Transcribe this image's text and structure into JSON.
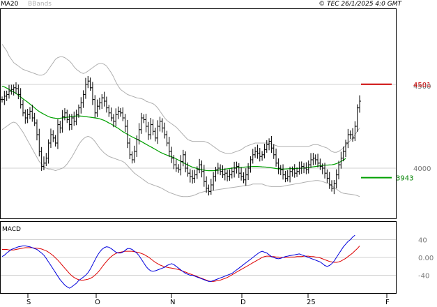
{
  "header": {
    "legend_ma": "MA20",
    "legend_bbands": "BBands",
    "copyright": "© TEC 26/1/2025 4:0 GMT"
  },
  "colors": {
    "ma20": "#00a000",
    "bbands": "#b0b0b0",
    "bars": "#000000",
    "macd_line": "#0000dd",
    "signal_line": "#dd0000",
    "resistance": "#cc0000",
    "support": "#00a000",
    "grid": "#d0d0d0",
    "axis": "#000000"
  },
  "chart_data": [
    {
      "type": "line",
      "title": "",
      "xlabel": "",
      "ylabel": "",
      "ylim": [
        3700,
        4950
      ],
      "x_tick_labels": [
        "S",
        "O",
        "N",
        "D",
        "25",
        "F"
      ],
      "y_tick_labels": [
        "4500",
        "4000"
      ],
      "levels": [
        {
          "name": "resistance",
          "label": "4501",
          "value": 4501
        },
        {
          "name": "support",
          "label": "3943",
          "value": 3943
        }
      ],
      "series": [
        {
          "name": "price",
          "style": "ohlc-bars",
          "values": [
            4410,
            4430,
            4440,
            4460,
            4470,
            4480,
            4475,
            4440,
            4380,
            4330,
            4300,
            4320,
            4340,
            4300,
            4270,
            4200,
            4100,
            4010,
            4030,
            4060,
            4150,
            4200,
            4180,
            4150,
            4260,
            4240,
            4310,
            4330,
            4290,
            4260,
            4300,
            4280,
            4320,
            4360,
            4390,
            4440,
            4500,
            4520,
            4480,
            4410,
            4330,
            4370,
            4390,
            4420,
            4400,
            4360,
            4330,
            4300,
            4280,
            4320,
            4340,
            4330,
            4300,
            4250,
            4150,
            4080,
            4050,
            4100,
            4170,
            4230,
            4300,
            4290,
            4250,
            4200,
            4260,
            4220,
            4180,
            4250,
            4280,
            4240,
            4200,
            4150,
            4100,
            4060,
            4020,
            4000,
            3990,
            4040,
            4080,
            4000,
            3970,
            3950,
            3940,
            3960,
            3990,
            4020,
            3980,
            3920,
            3880,
            3860,
            3900,
            3950,
            3990,
            4000,
            3980,
            3960,
            3970,
            3950,
            3960,
            3980,
            4000,
            4010,
            3970,
            3950,
            3930,
            3960,
            4000,
            4050,
            4080,
            4100,
            4090,
            4070,
            4080,
            4110,
            4140,
            4160,
            4120,
            4080,
            4030,
            4000,
            3990,
            3960,
            3940,
            3950,
            3980,
            3990,
            3970,
            3980,
            4000,
            4010,
            4000,
            3990,
            4020,
            4050,
            4060,
            4050,
            4030,
            4010,
            4000,
            3970,
            3940,
            3900,
            3880,
            3910,
            3960,
            4020,
            4060,
            4100,
            4150,
            4200,
            4200,
            4180,
            4250,
            4360,
            4400
          ]
        },
        {
          "name": "MA20",
          "values": [
            4490,
            4485,
            4478,
            4470,
            4462,
            4455,
            4446,
            4436,
            4425,
            4414,
            4404,
            4394,
            4383,
            4372,
            4360,
            4348,
            4338,
            4330,
            4322,
            4315,
            4308,
            4303,
            4300,
            4298,
            4297,
            4298,
            4300,
            4302,
            4304,
            4306,
            4308,
            4310,
            4312,
            4312,
            4311,
            4310,
            4308,
            4306,
            4304,
            4302,
            4300,
            4298,
            4295,
            4290,
            4285,
            4278,
            4270,
            4263,
            4255,
            4246,
            4238,
            4228,
            4218,
            4210,
            4202,
            4194,
            4187,
            4180,
            4173,
            4166,
            4159,
            4151,
            4143,
            4135,
            4128,
            4120,
            4112,
            4104,
            4096,
            4089,
            4083,
            4078,
            4073,
            4068,
            4062,
            4056,
            4048,
            4040,
            4033,
            4026,
            4018,
            4012,
            4006,
            4002,
            3998,
            3994,
            3990,
            3988,
            3986,
            3985,
            3985,
            3985,
            3986,
            3988,
            3990,
            3992,
            3994,
            3996,
            3998,
            4000,
            4002,
            4003,
            4004,
            4005,
            4006,
            4007,
            4008,
            4009,
            4010,
            4010,
            4010,
            4009,
            4008,
            4007,
            4006,
            4004,
            4002,
            4000,
            3998,
            3996,
            3994,
            3994,
            3995,
            3996,
            3997,
            3998,
            3998,
            3998,
            3999,
            4000,
            4001,
            4002,
            4004,
            4006,
            4008,
            4010,
            4012,
            4014,
            4016,
            4018,
            4018,
            4019,
            4020,
            4023,
            4027,
            4033,
            4040,
            4048,
            4058
          ]
        },
        {
          "name": "BBands upper",
          "values": [
            4740,
            4720,
            4700,
            4670,
            4650,
            4630,
            4620,
            4610,
            4600,
            4590,
            4585,
            4580,
            4575,
            4570,
            4565,
            4560,
            4555,
            4555,
            4560,
            4570,
            4590,
            4610,
            4630,
            4650,
            4660,
            4665,
            4665,
            4660,
            4650,
            4640,
            4625,
            4605,
            4590,
            4580,
            4570,
            4565,
            4570,
            4580,
            4590,
            4600,
            4610,
            4620,
            4625,
            4625,
            4620,
            4610,
            4590,
            4570,
            4545,
            4515,
            4490,
            4470,
            4460,
            4450,
            4440,
            4435,
            4430,
            4425,
            4420,
            4418,
            4415,
            4410,
            4400,
            4395,
            4390,
            4385,
            4375,
            4360,
            4340,
            4320,
            4300,
            4285,
            4275,
            4265,
            4255,
            4245,
            4230,
            4215,
            4200,
            4185,
            4170,
            4165,
            4160,
            4160,
            4160,
            4160,
            4160,
            4160,
            4155,
            4150,
            4140,
            4130,
            4120,
            4110,
            4100,
            4095,
            4090,
            4088,
            4088,
            4090,
            4095,
            4100,
            4105,
            4110,
            4120,
            4130,
            4135,
            4140,
            4145,
            4150,
            4150,
            4150,
            4150,
            4150,
            4150,
            4148,
            4145,
            4140,
            4135,
            4130,
            4130,
            4130,
            4130,
            4130,
            4130,
            4130,
            4130,
            4130,
            4130,
            4130,
            4130,
            4130,
            4130,
            4135,
            4140,
            4140,
            4140,
            4135,
            4130,
            4125,
            4120,
            4110,
            4100,
            4095,
            4095,
            4100,
            4110,
            4120,
            4135,
            4150,
            4165,
            4180,
            4200,
            4220,
            4240
          ]
        },
        {
          "name": "BBands lower",
          "values": [
            4230,
            4240,
            4250,
            4260,
            4270,
            4275,
            4270,
            4255,
            4235,
            4215,
            4190,
            4165,
            4140,
            4115,
            4090,
            4065,
            4040,
            4025,
            4010,
            4000,
            3995,
            3995,
            3990,
            3985,
            3990,
            3995,
            4000,
            4010,
            4025,
            4045,
            4065,
            4090,
            4115,
            4140,
            4160,
            4175,
            4185,
            4190,
            4185,
            4175,
            4160,
            4140,
            4120,
            4105,
            4090,
            4080,
            4070,
            4065,
            4060,
            4055,
            4050,
            4045,
            4040,
            4030,
            4015,
            4000,
            3985,
            3970,
            3960,
            3950,
            3940,
            3930,
            3920,
            3910,
            3905,
            3900,
            3895,
            3890,
            3885,
            3878,
            3870,
            3862,
            3855,
            3850,
            3845,
            3840,
            3835,
            3832,
            3830,
            3830,
            3830,
            3832,
            3835,
            3840,
            3846,
            3852,
            3856,
            3860,
            3862,
            3864,
            3866,
            3868,
            3870,
            3872,
            3874,
            3876,
            3878,
            3880,
            3882,
            3884,
            3886,
            3888,
            3890,
            3892,
            3894,
            3896,
            3898,
            3900,
            3905,
            3905,
            3905,
            3905,
            3905,
            3900,
            3895,
            3892,
            3890,
            3890,
            3890,
            3890,
            3890,
            3892,
            3895,
            3898,
            3900,
            3902,
            3905,
            3908,
            3910,
            3912,
            3915,
            3918,
            3920,
            3922,
            3924,
            3926,
            3926,
            3924,
            3920,
            3915,
            3910,
            3905,
            3895,
            3885,
            3875,
            3865,
            3855,
            3850,
            3848,
            3846,
            3844,
            3842,
            3840,
            3836,
            3830
          ]
        }
      ]
    },
    {
      "type": "line",
      "title": "MACD",
      "ylim": [
        -80,
        80
      ],
      "y_tick_labels": [
        "40",
        "0.00",
        "-40"
      ],
      "series": [
        {
          "name": "MACD",
          "values": [
            2,
            5,
            10,
            14,
            18,
            20,
            22,
            24,
            25,
            26,
            26,
            25,
            24,
            22,
            20,
            18,
            14,
            10,
            5,
            -2,
            -10,
            -18,
            -26,
            -34,
            -42,
            -50,
            -56,
            -62,
            -66,
            -69,
            -66,
            -62,
            -58,
            -52,
            -48,
            -44,
            -40,
            -34,
            -26,
            -16,
            -6,
            4,
            12,
            18,
            22,
            24,
            23,
            20,
            16,
            12,
            10,
            10,
            12,
            16,
            20,
            20,
            18,
            14,
            10,
            4,
            -4,
            -12,
            -20,
            -26,
            -30,
            -31,
            -30,
            -28,
            -26,
            -24,
            -22,
            -18,
            -16,
            -14,
            -16,
            -20,
            -24,
            -28,
            -32,
            -36,
            -38,
            -40,
            -40,
            -42,
            -44,
            -46,
            -48,
            -50,
            -52,
            -54,
            -54,
            -52,
            -50,
            -48,
            -46,
            -44,
            -42,
            -40,
            -38,
            -36,
            -32,
            -28,
            -24,
            -20,
            -16,
            -12,
            -8,
            -4,
            0,
            4,
            8,
            12,
            14,
            12,
            10,
            6,
            2,
            0,
            -2,
            -3,
            -2,
            0,
            2,
            3,
            4,
            5,
            6,
            7,
            8,
            6,
            4,
            2,
            0,
            -2,
            -4,
            -6,
            -8,
            -10,
            -14,
            -18,
            -20,
            -18,
            -14,
            -8,
            0,
            8,
            16,
            24,
            30,
            36,
            40,
            46,
            50
          ]
        },
        {
          "name": "Signal",
          "values": [
            18,
            18,
            18,
            17,
            17,
            17,
            18,
            19,
            20,
            21,
            22,
            22,
            22,
            22,
            21,
            21,
            20,
            19,
            17,
            15,
            12,
            8,
            4,
            -1,
            -6,
            -12,
            -18,
            -24,
            -30,
            -36,
            -41,
            -45,
            -48,
            -50,
            -51,
            -51,
            -50,
            -49,
            -47,
            -44,
            -40,
            -35,
            -29,
            -22,
            -15,
            -9,
            -3,
            2,
            6,
            9,
            11,
            12,
            13,
            14,
            14,
            14,
            14,
            13,
            12,
            11,
            9,
            7,
            4,
            1,
            -3,
            -7,
            -11,
            -14,
            -17,
            -19,
            -21,
            -22,
            -23,
            -24,
            -25,
            -26,
            -27,
            -29,
            -31,
            -33,
            -35,
            -37,
            -39,
            -41,
            -43,
            -45,
            -47,
            -49,
            -51,
            -53,
            -54,
            -54,
            -53,
            -52,
            -51,
            -49,
            -47,
            -45,
            -42,
            -39,
            -36,
            -33,
            -30,
            -27,
            -24,
            -21,
            -18,
            -15,
            -12,
            -9,
            -6,
            -3,
            0,
            2,
            3,
            3,
            2,
            2,
            1,
            1,
            0,
            0,
            0,
            0,
            1,
            1,
            1,
            2,
            2,
            2,
            3,
            3,
            3,
            2,
            2,
            1,
            0,
            -1,
            -3,
            -5,
            -7,
            -9,
            -10,
            -11,
            -11,
            -10,
            -8,
            -5,
            -2,
            2,
            6,
            10,
            15,
            20,
            26
          ]
        }
      ]
    }
  ]
}
